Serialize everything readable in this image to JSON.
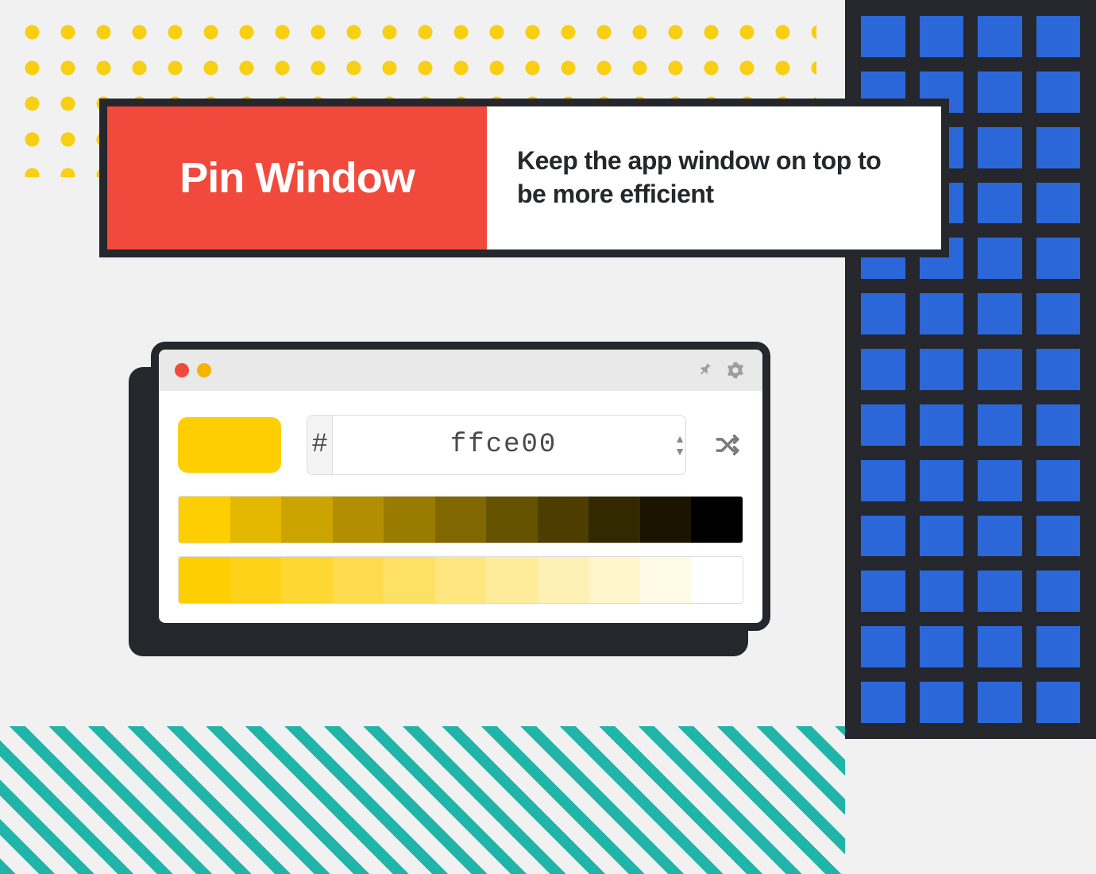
{
  "header": {
    "title": "Pin Window",
    "description": "Keep the app window on top to be more efficient"
  },
  "window": {
    "traffic_lights": [
      "close",
      "minimize"
    ],
    "toolbar_icons": [
      "pin-icon",
      "gear-icon"
    ],
    "hex_prefix": "#",
    "hex_value": "ffce00",
    "swatch_color": "#ffce00",
    "shades": [
      "#ffce00",
      "#e5b800",
      "#cca400",
      "#b28f00",
      "#997b00",
      "#806700",
      "#665300",
      "#4d3e00",
      "#332900",
      "#1a1400",
      "#000000"
    ],
    "tints": [
      "#ffce00",
      "#ffd21a",
      "#ffd733",
      "#ffdc4d",
      "#ffe066",
      "#ffe680",
      "#ffeb99",
      "#fff0b3",
      "#fff5cc",
      "#fffae6",
      "#ffffff"
    ]
  }
}
